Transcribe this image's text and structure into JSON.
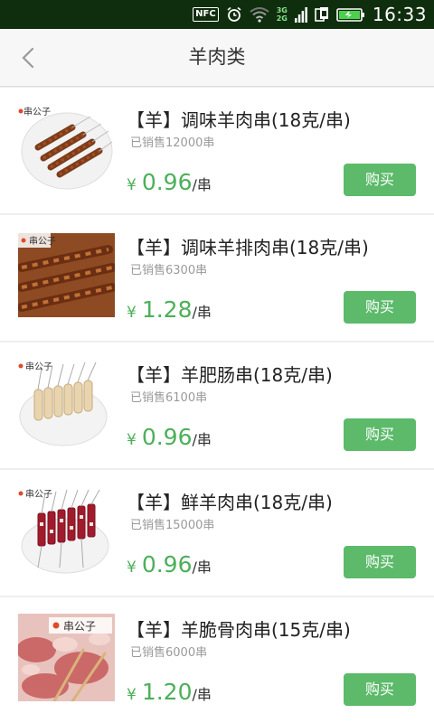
{
  "status_bar": {
    "nfc": "NFC",
    "network_top": "3G",
    "network_bottom": "2G",
    "time": "16:33"
  },
  "header": {
    "title": "羊肉类",
    "back_icon": "chevron-left-icon"
  },
  "products": [
    {
      "name": "【羊】调味羊肉串(18克/串)",
      "sold": "已销售12000串",
      "currency": "¥",
      "price": "0.96",
      "unit": "/串",
      "buy_label": "购买",
      "brand": "串公子"
    },
    {
      "name": "【羊】调味羊排肉串(18克/串)",
      "sold": "已销售6300串",
      "currency": "¥",
      "price": "1.28",
      "unit": "/串",
      "buy_label": "购买",
      "brand": "串公子"
    },
    {
      "name": "【羊】羊肥肠串(18克/串)",
      "sold": "已销售6100串",
      "currency": "¥",
      "price": "0.96",
      "unit": "/串",
      "buy_label": "购买",
      "brand": "串公子"
    },
    {
      "name": "【羊】鲜羊肉串(18克/串)",
      "sold": "已销售15000串",
      "currency": "¥",
      "price": "0.96",
      "unit": "/串",
      "buy_label": "购买",
      "brand": "串公子"
    },
    {
      "name": "【羊】羊脆骨肉串(15克/串)",
      "sold": "已销售6000串",
      "currency": "¥",
      "price": "1.20",
      "unit": "/串",
      "buy_label": "购买",
      "brand": "串公子"
    }
  ],
  "colors": {
    "status_bar_bg": "#0f2e0e",
    "price_green": "#4cb05a",
    "buy_button_green": "#5cba6a"
  }
}
